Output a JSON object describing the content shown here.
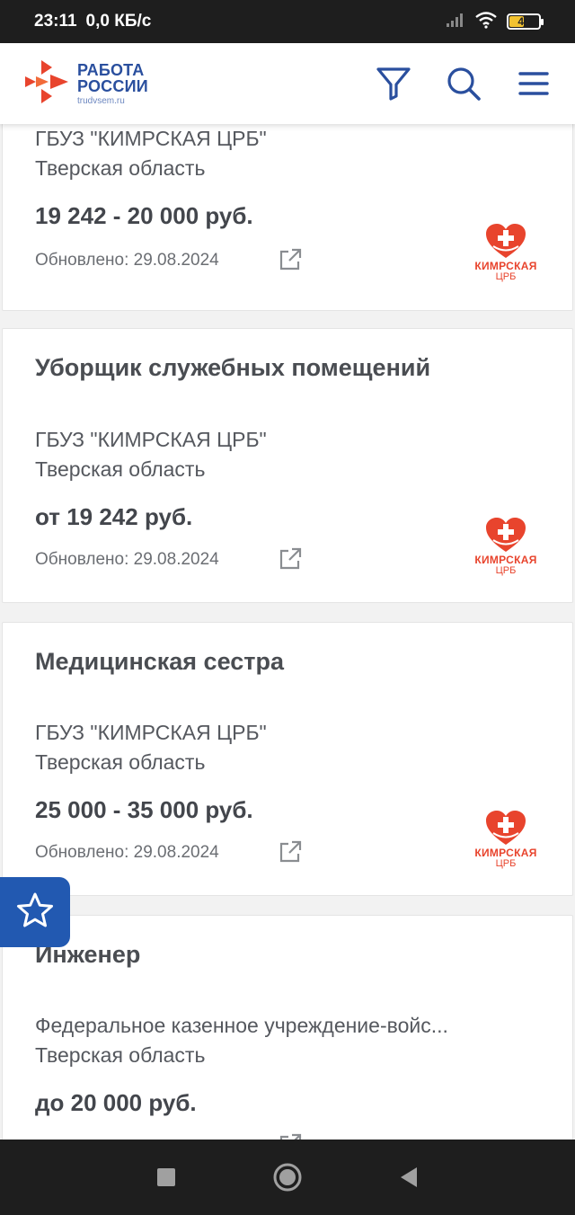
{
  "status_bar": {
    "time": "23:11",
    "speed": "0,0 КБ/с",
    "battery_level": "47",
    "icons": [
      "signal-icon",
      "wifi-icon",
      "battery-icon"
    ]
  },
  "header": {
    "logo_line1": "РАБОТА",
    "logo_line2": "РОССИИ",
    "logo_sub": "trudvsem.ru",
    "icons": [
      "filter-icon",
      "search-icon",
      "menu-icon"
    ],
    "brand_color": "#2a4f9e",
    "accent_color": "#e8442d"
  },
  "vacancies": [
    {
      "title": "",
      "company": "ГБУЗ \"КИМРСКАЯ ЦРБ\"",
      "region": "Тверская область",
      "salary": "19 242 - 20 000 руб.",
      "updated": "Обновлено: 29.08.2024",
      "logo_name": "КИМРСКАЯ",
      "logo_sub": "ЦРБ"
    },
    {
      "title": "Уборщик служебных помещений",
      "company": "ГБУЗ \"КИМРСКАЯ ЦРБ\"",
      "region": "Тверская область",
      "salary": "от 19 242 руб.",
      "updated": "Обновлено: 29.08.2024",
      "logo_name": "КИМРСКАЯ",
      "logo_sub": "ЦРБ"
    },
    {
      "title": "Медицинская сестра",
      "company": "ГБУЗ \"КИМРСКАЯ ЦРБ\"",
      "region": "Тверская область",
      "salary": "25 000 - 35 000 руб.",
      "updated": "Обновлено: 29.08.2024",
      "logo_name": "КИМРСКАЯ",
      "logo_sub": "ЦРБ"
    },
    {
      "title": "Инженер",
      "company": "Федеральное казенное учреждение-войс...",
      "region": "Тверская область",
      "salary": "до 20 000 руб."
    }
  ],
  "favorites_button_icon": "star-icon",
  "nav_bar": {
    "icons": [
      "recents-icon",
      "home-icon",
      "back-icon"
    ]
  }
}
